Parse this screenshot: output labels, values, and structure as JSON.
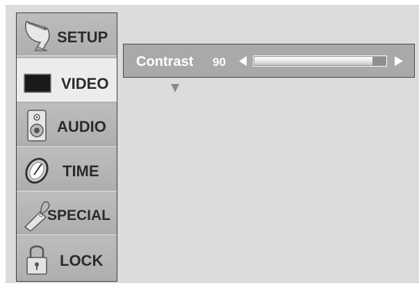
{
  "menu": {
    "items": [
      {
        "label": "SETUP",
        "icon": "satellite-dish-icon"
      },
      {
        "label": "VIDEO",
        "icon": "tv-screen-icon",
        "active": true
      },
      {
        "label": "AUDIO",
        "icon": "speaker-icon"
      },
      {
        "label": "TIME",
        "icon": "clock-icon"
      },
      {
        "label": "SPECIAL",
        "icon": "tag-icon"
      },
      {
        "label": "LOCK",
        "icon": "padlock-icon"
      }
    ]
  },
  "adjustment": {
    "label": "Contrast",
    "value": "90",
    "level_percent": 90
  },
  "colors": {
    "panel": "#dcdcdc",
    "sidebar": "#b7b7b7",
    "active_item": "#ececec",
    "bar": "#a9a9a9",
    "text_light": "#ffffff",
    "text_dark": "#2b2b2b"
  }
}
